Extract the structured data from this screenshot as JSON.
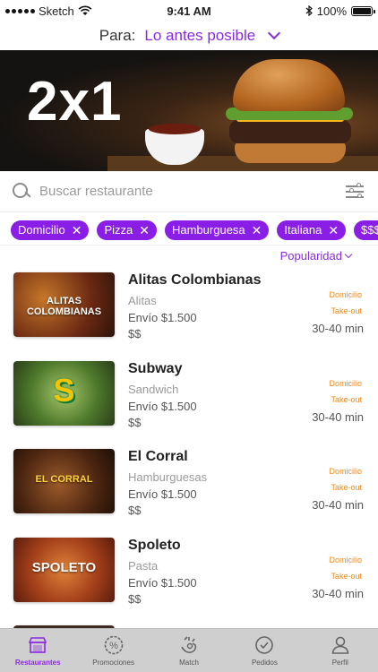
{
  "status_bar": {
    "carrier": "Sketch",
    "time": "9:41 AM",
    "battery": "100%",
    "battery_level": 1.0
  },
  "delivery": {
    "label": "Para:",
    "value": "Lo antes posible",
    "accent_color": "#8a2be2"
  },
  "banner": {
    "text": "2x1"
  },
  "search": {
    "placeholder": "Buscar restaurante",
    "icon": "search-icon",
    "filter_icon": "sliders-icon"
  },
  "filters": [
    {
      "label": "Domicilio"
    },
    {
      "label": "Pizza"
    },
    {
      "label": "Hamburguesa"
    },
    {
      "label": "Italiana"
    },
    {
      "label": "$$$$"
    }
  ],
  "sort": {
    "label": "Popularidad"
  },
  "restaurants": [
    {
      "name": "Alitas Colombianas",
      "category": "Alitas",
      "fee": "Envío $1.500",
      "price": "$$",
      "tags": [
        "Domicilio",
        "Take-out"
      ],
      "time": "30-40 min",
      "logo": "ALITAS COLOMBIANAS",
      "thumb_color": "#8b3a1a"
    },
    {
      "name": "Subway",
      "category": "Sandwich",
      "fee": "Envío $1.500",
      "price": "$$",
      "tags": [
        "Domicilio",
        "Take-out"
      ],
      "time": "30-40 min",
      "logo": "S",
      "thumb_color": "#6f8e3a"
    },
    {
      "name": "El Corral",
      "category": "Hamburguesas",
      "fee": "Envío $1.500",
      "price": "$$",
      "tags": [
        "Domicilio",
        "Take-out"
      ],
      "time": "30-40 min",
      "logo": "EL CORRAL",
      "thumb_color": "#6b3b1e"
    },
    {
      "name": "Spoleto",
      "category": "Pasta",
      "fee": "Envío $1.500",
      "price": "$$",
      "tags": [
        "Domicilio",
        "Take-out"
      ],
      "time": "30-40 min",
      "logo": "SPOLETO",
      "thumb_color": "#b5561f"
    }
  ],
  "tabs": [
    {
      "label": "Restaurantes",
      "icon": "store-icon",
      "active": true
    },
    {
      "label": "Promociones",
      "icon": "percent-badge-icon",
      "active": false
    },
    {
      "label": "Match",
      "icon": "match-hand-icon",
      "active": false
    },
    {
      "label": "Pedidos",
      "icon": "clock-check-icon",
      "active": false
    },
    {
      "label": "Perfil",
      "icon": "user-icon",
      "active": false
    }
  ],
  "colors": {
    "accent": "#8a2be2",
    "chip": "#8b1ee6",
    "tag": "#f08a1d"
  }
}
